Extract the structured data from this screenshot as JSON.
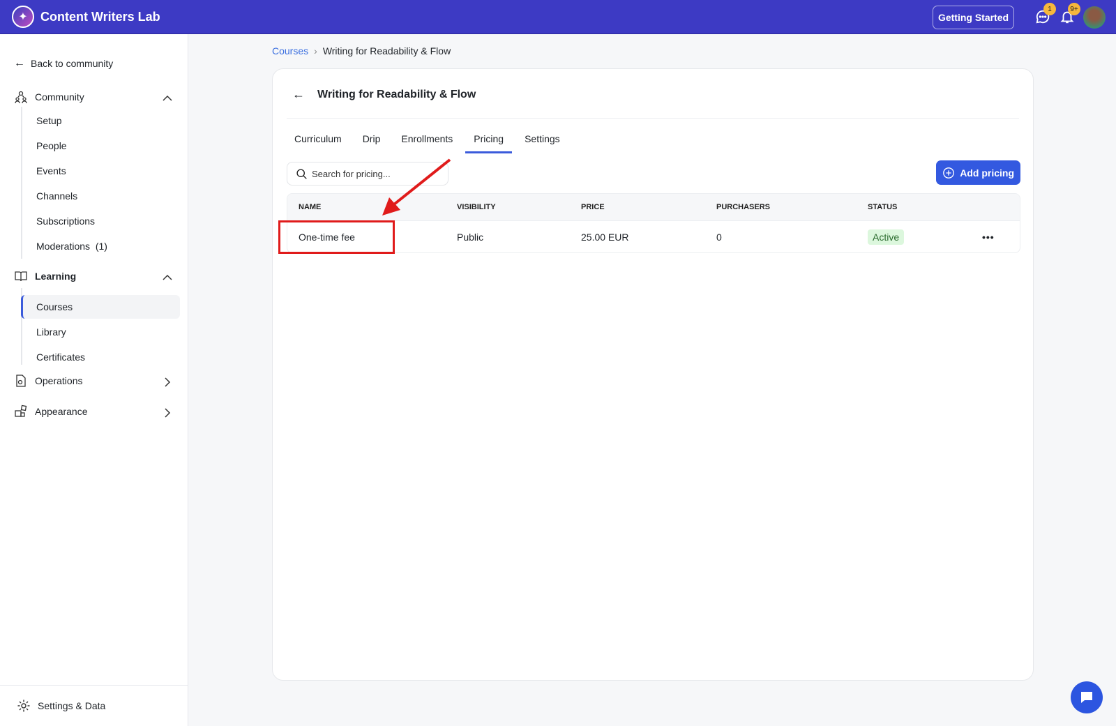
{
  "header": {
    "app_title": "Content Writers Lab",
    "getting_started": "Getting Started",
    "messages_badge": "1",
    "notifications_badge": "9+"
  },
  "sidebar": {
    "back": "Back to community",
    "community": {
      "label": "Community",
      "items": [
        "Setup",
        "People",
        "Events",
        "Channels",
        "Subscriptions",
        "Moderations  (1)"
      ]
    },
    "learning": {
      "label": "Learning",
      "items": [
        "Courses",
        "Library",
        "Certificates"
      ]
    },
    "operations": "Operations",
    "appearance": "Appearance",
    "settings": "Settings & Data"
  },
  "breadcrumb": {
    "root": "Courses",
    "current": "Writing for Readability & Flow"
  },
  "course": {
    "title": "Writing for Readability & Flow",
    "tabs": [
      "Curriculum",
      "Drip",
      "Enrollments",
      "Pricing",
      "Settings"
    ],
    "active_tab": "Pricing",
    "search_placeholder": "Search for pricing...",
    "add_pricing": "Add pricing",
    "columns": [
      "NAME",
      "VISIBILITY",
      "PRICE",
      "PURCHASERS",
      "STATUS"
    ],
    "rows": [
      {
        "name": "One-time fee",
        "visibility": "Public",
        "price": "25.00 EUR",
        "purchasers": "0",
        "status": "Active"
      }
    ]
  },
  "colors": {
    "header": "#3d3ac4",
    "accent": "#3359e0",
    "annotation": "#e01b1b"
  }
}
